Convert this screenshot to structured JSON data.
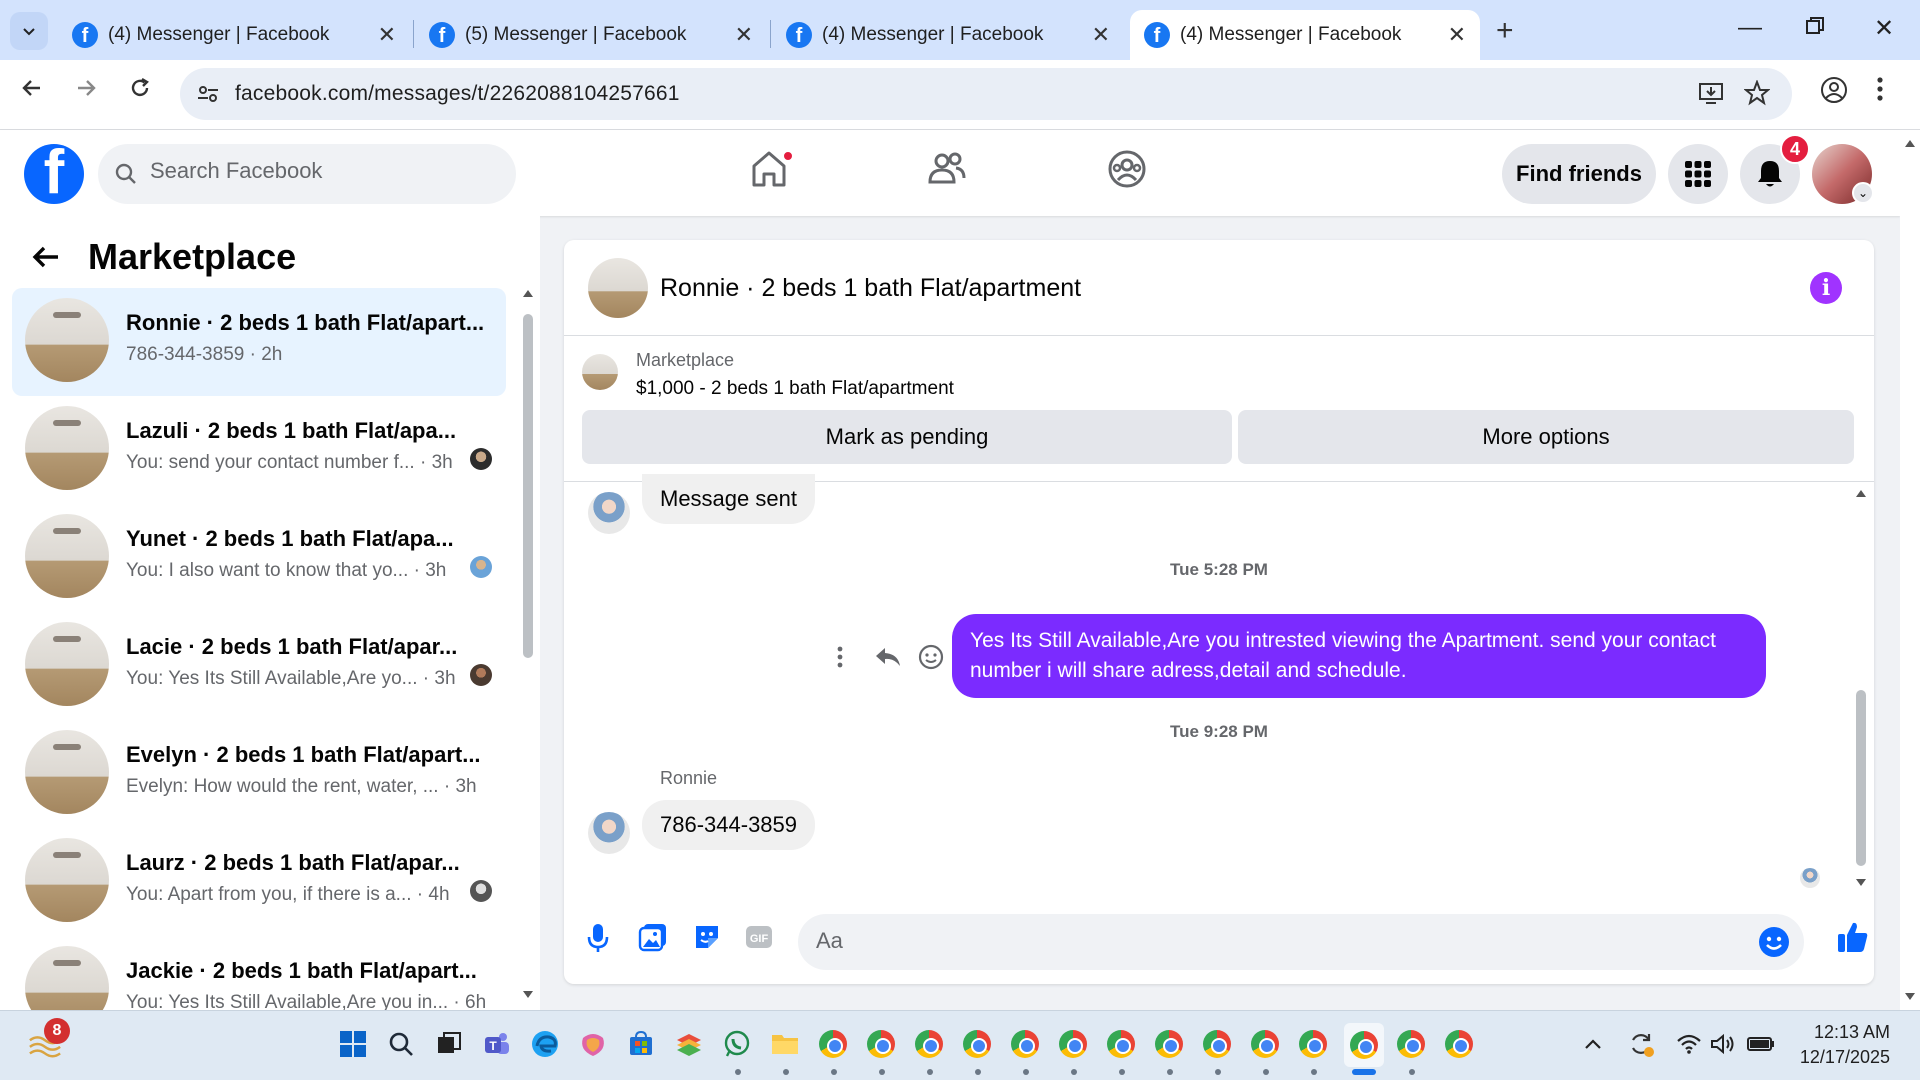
{
  "browser": {
    "tabs": [
      {
        "title": "(4) Messenger | Facebook",
        "active": false
      },
      {
        "title": "(5) Messenger | Facebook",
        "active": false
      },
      {
        "title": "(4) Messenger | Facebook",
        "active": false
      },
      {
        "title": "(4) Messenger | Facebook",
        "active": true
      }
    ],
    "url": "facebook.com/messages/t/2262088104257661"
  },
  "fb_header": {
    "logo": "f",
    "search_placeholder": "Search Facebook",
    "find_friends_label": "Find friends",
    "notification_count": "4"
  },
  "sidebar": {
    "title": "Marketplace",
    "conversations": [
      {
        "name": "Ronnie · 2 beds 1 bath Flat/apart...",
        "message": "786-344-3859 · 2h",
        "selected": true
      },
      {
        "name": "Lazuli · 2 beds 1 bath Flat/apa...",
        "message": "You: send your contact number f... · 3h",
        "selected": false
      },
      {
        "name": "Yunet · 2 beds 1 bath Flat/apa...",
        "message": "You: I also want to know that yo... · 3h",
        "selected": false
      },
      {
        "name": "Lacie · 2 beds 1 bath Flat/apar...",
        "message": "You: Yes Its Still Available,Are yo... · 3h",
        "selected": false
      },
      {
        "name": "Evelyn · 2 beds 1 bath Flat/apart...",
        "message": "Evelyn: How would the rent, water, ... · 3h",
        "selected": false
      },
      {
        "name": "Laurz · 2 beds 1 bath Flat/apar...",
        "message": "You: Apart from you, if there is a... · 4h",
        "selected": false
      },
      {
        "name": "Jackie · 2 beds 1 bath Flat/apart...",
        "message": "You: Yes Its Still Available,Are you in... · 6h",
        "selected": false
      }
    ]
  },
  "chat": {
    "title": "Ronnie · 2 beds 1 bath Flat/apartment",
    "listing": {
      "label": "Marketplace",
      "description": "$1,000 - 2 beds 1 bath Flat/apartment",
      "mark_pending_label": "Mark as pending",
      "more_options_label": "More options"
    },
    "messages": {
      "first_incoming": "Message sent",
      "timestamp_1": "Tue 5:28 PM",
      "outgoing": "Yes Its Still Available,Are you intrested viewing the Apartment. send your contact number i will share adress,detail and schedule.",
      "timestamp_2": "Tue 9:28 PM",
      "sender_name": "Ronnie",
      "reply": "786-344-3859"
    },
    "composer_placeholder": "Aa"
  },
  "taskbar": {
    "widget_badge": "8",
    "time": "12:13 AM",
    "date": "12/17/2025"
  },
  "colors": {
    "fb_blue": "#0866ff",
    "outgoing_bubble": "#7b2bff",
    "selected_row": "#e7f3ff",
    "notification_red": "#e41e3f"
  }
}
